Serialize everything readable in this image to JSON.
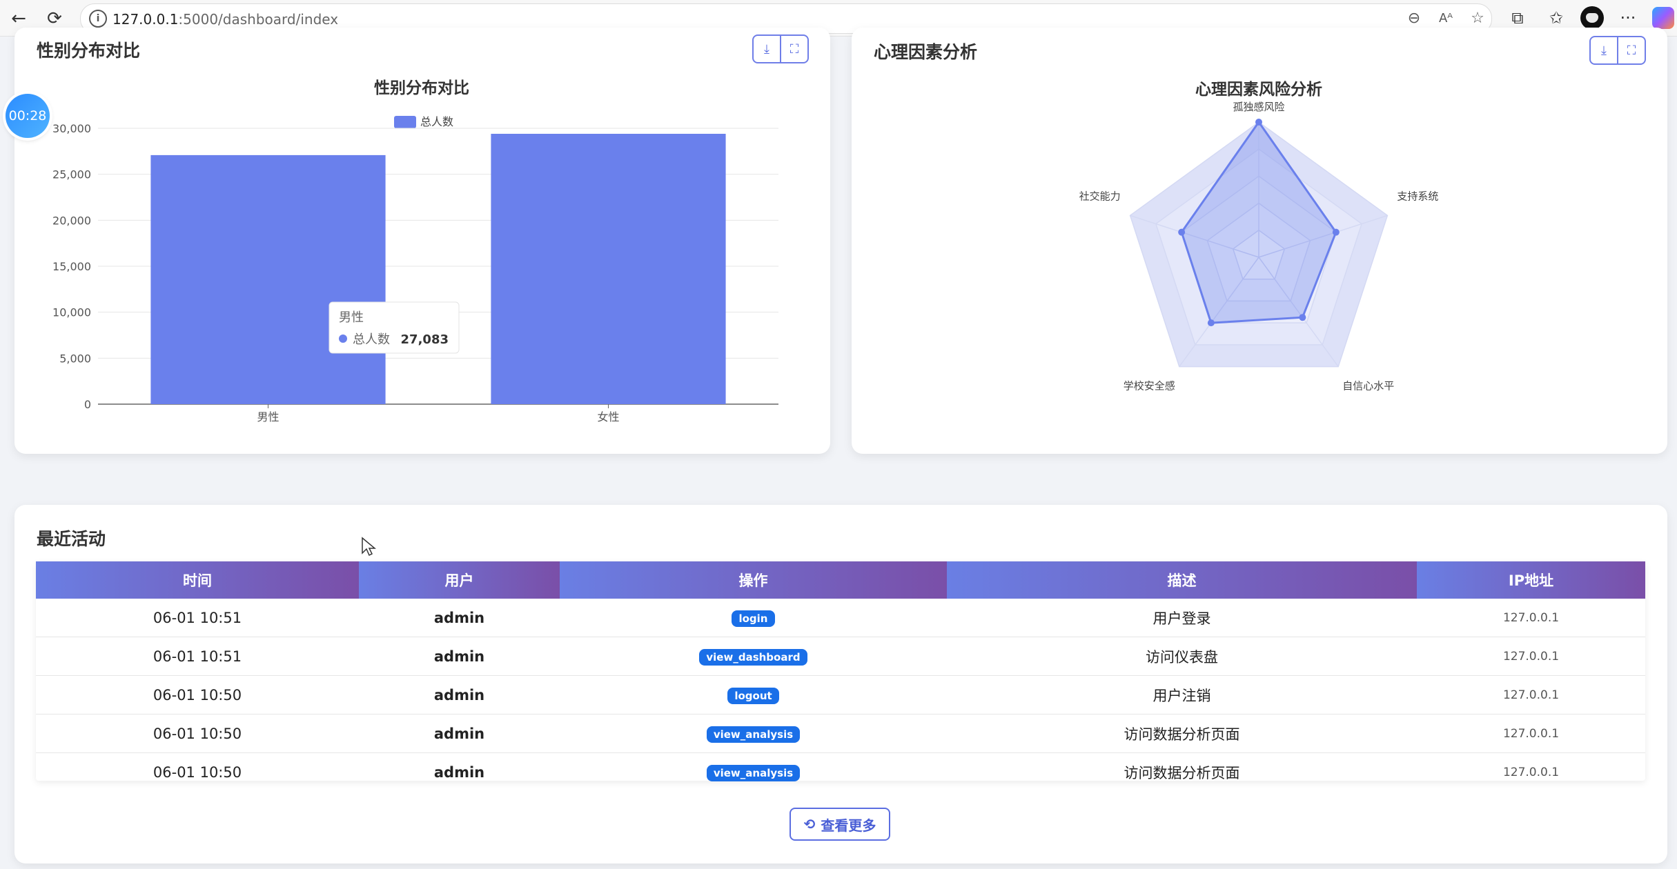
{
  "browser": {
    "url_host": "127.0.0.1",
    "url_path": ":5000/dashboard/index"
  },
  "timer": "00:28",
  "gender_card": {
    "title": "性别分布对比",
    "chart_title": "性别分布对比",
    "legend": "总人数",
    "tooltip": {
      "category": "男性",
      "series": "总人数",
      "value": "27,083"
    }
  },
  "radar_card": {
    "title": "心理因素分析",
    "chart_title": "心理因素风险分析"
  },
  "activity": {
    "title": "最近活动",
    "headers": [
      "时间",
      "用户",
      "操作",
      "描述",
      "IP地址"
    ],
    "rows": [
      {
        "time": "06-01 10:51",
        "user": "admin",
        "action": "login",
        "desc": "用户登录",
        "ip": "127.0.0.1"
      },
      {
        "time": "06-01 10:51",
        "user": "admin",
        "action": "view_dashboard",
        "desc": "访问仪表盘",
        "ip": "127.0.0.1"
      },
      {
        "time": "06-01 10:50",
        "user": "admin",
        "action": "logout",
        "desc": "用户注销",
        "ip": "127.0.0.1"
      },
      {
        "time": "06-01 10:50",
        "user": "admin",
        "action": "view_analysis",
        "desc": "访问数据分析页面",
        "ip": "127.0.0.1"
      },
      {
        "time": "06-01 10:50",
        "user": "admin",
        "action": "view_analysis",
        "desc": "访问数据分析页面",
        "ip": "127.0.0.1"
      }
    ],
    "more_label": "查看更多"
  },
  "chart_data": [
    {
      "type": "bar",
      "title": "性别分布对比",
      "categories": [
        "男性",
        "女性"
      ],
      "series": [
        {
          "name": "总人数",
          "values": [
            27083,
            29400
          ]
        }
      ],
      "ylim": [
        0,
        30000
      ],
      "yticks": [
        "0",
        "5,000",
        "10,000",
        "15,000",
        "20,000",
        "25,000",
        "30,000"
      ],
      "grid": true,
      "legend": "top",
      "color": "#6a80ec"
    },
    {
      "type": "radar",
      "title": "心理因素风险分析",
      "indicators": [
        "孤独感风险",
        "支持系统",
        "自信心水平",
        "学校安全感",
        "社交能力"
      ],
      "values": [
        1.0,
        0.6,
        0.55,
        0.6,
        0.6
      ],
      "max": 1,
      "color": "#6a80ec"
    }
  ]
}
